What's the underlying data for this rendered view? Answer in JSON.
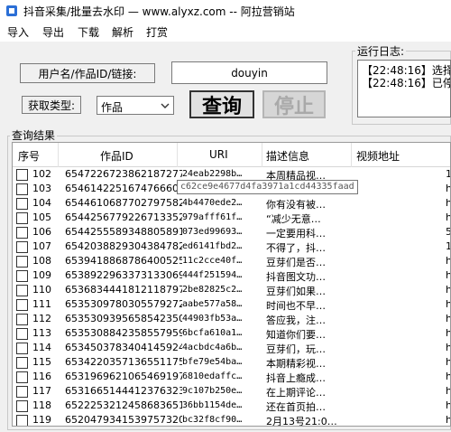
{
  "window": {
    "title": "抖音采集/批量去水印 — www.alyxz.com -- 阿拉营销站"
  },
  "menu": [
    "导入",
    "导出",
    "下载",
    "解析",
    "打赏"
  ],
  "query": {
    "input_label": "用户名/作品ID/链接:",
    "input_value": "douyin",
    "type_label": "获取类型:",
    "type_value": "作品",
    "search_label": "查询",
    "stop_label": "停止"
  },
  "log": {
    "title": "运行日志:",
    "lines": [
      "【22:48:16】选择了",
      "【22:48:16】已停止"
    ]
  },
  "results": {
    "title": "查询结果",
    "columns": [
      "序号",
      "作品ID",
      "URI",
      "描述信息",
      "视频地址"
    ],
    "tooltip": "c62ce9e4677d4fa3971a1cd44335faad",
    "rows": [
      {
        "seq": "102",
        "id": "6547226723862187277",
        "uri": "24eab2298b…",
        "desc": "本周精品视…",
        "last": "1"
      },
      {
        "seq": "103",
        "id": "6546142251674766600",
        "uri": "c62ce9e46…",
        "desc": "",
        "last": "h"
      },
      {
        "seq": "104",
        "id": "6544610687702797582",
        "uri": "4b4470ede2…",
        "desc": "你有没有被…",
        "last": "h"
      },
      {
        "seq": "105",
        "id": "6544256779226713352",
        "uri": "979afff61f…",
        "desc": "“减少无意…",
        "last": "h"
      },
      {
        "seq": "106",
        "id": "6544255589348805891",
        "uri": "073ed99693…",
        "desc": "一定要用科…",
        "last": "5"
      },
      {
        "seq": "107",
        "id": "6542038829304384782",
        "uri": "ed6141fbd2…",
        "desc": "不得了，抖…",
        "last": "1"
      },
      {
        "seq": "108",
        "id": "6539418868786400525",
        "uri": "11c2cce40f…",
        "desc": "豆芽们是否…",
        "last": "h"
      },
      {
        "seq": "109",
        "id": "6538922963373133069",
        "uri": "444f251594…",
        "desc": "抖音图文功…",
        "last": "h"
      },
      {
        "seq": "110",
        "id": "6536834441812118797",
        "uri": "2be82825c2…",
        "desc": "豆芽们如果…",
        "last": "h"
      },
      {
        "seq": "111",
        "id": "6535309780305579272",
        "uri": "aabe577a58…",
        "desc": "时间也不早…",
        "last": "h"
      },
      {
        "seq": "112",
        "id": "6535309395658542350",
        "uri": "44903fb53a…",
        "desc": "答应我，注…",
        "last": "h"
      },
      {
        "seq": "113",
        "id": "6535308842358557959",
        "uri": "6bcfa610a1…",
        "desc": "知道你们要…",
        "last": "h"
      },
      {
        "seq": "114",
        "id": "6534503783404145924",
        "uri": "4acbdc4a6b…",
        "desc": "豆芽们，玩…",
        "last": "h"
      },
      {
        "seq": "115",
        "id": "6534220357136551175",
        "uri": "bfe79e54ba…",
        "desc": "本期精彩视…",
        "last": "h"
      },
      {
        "seq": "116",
        "id": "6531969621065469197",
        "uri": "6810edaffc…",
        "desc": "抖音上瘾成…",
        "last": "h"
      },
      {
        "seq": "117",
        "id": "6531665144412376323",
        "uri": "9c107b250e…",
        "desc": "在上期评论…",
        "last": "h"
      },
      {
        "seq": "118",
        "id": "6522253212458683651",
        "uri": "36bb1154de…",
        "desc": "还在首页拍…",
        "last": "h"
      },
      {
        "seq": "119",
        "id": "6520479341539757320",
        "uri": "bc32f8cf90…",
        "desc": "2月13号21:0…",
        "last": "h"
      }
    ]
  }
}
